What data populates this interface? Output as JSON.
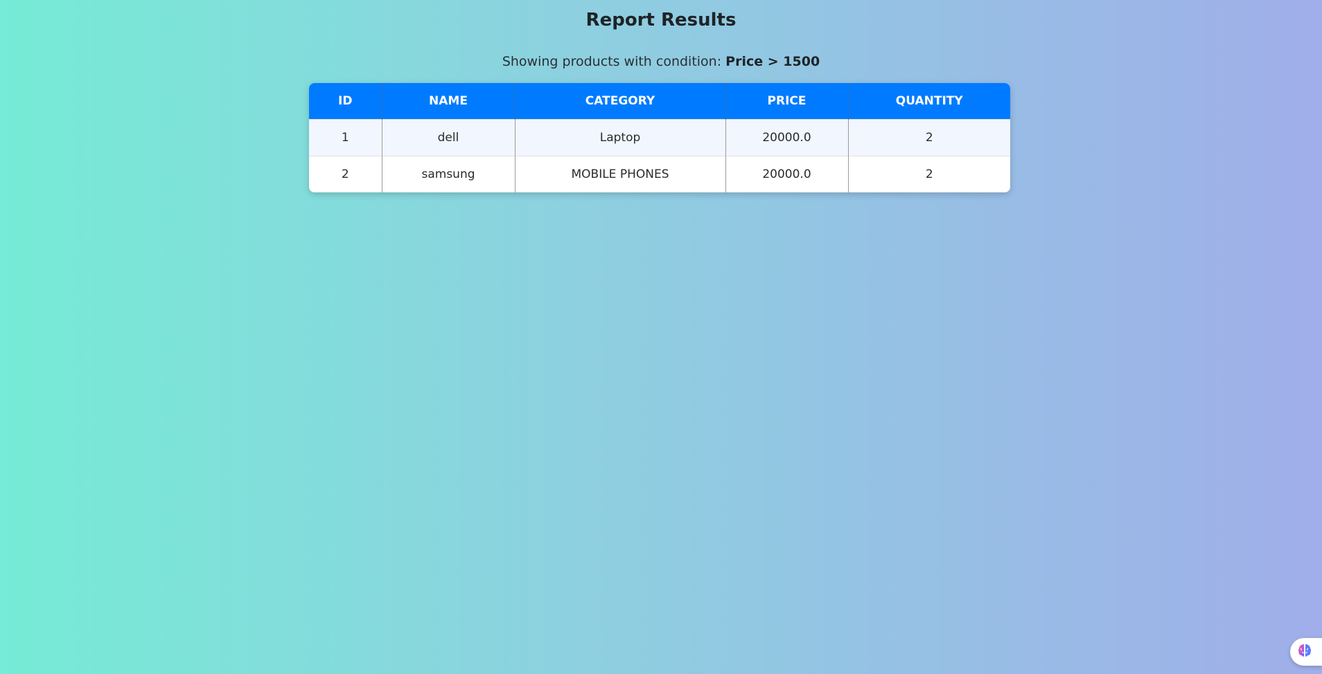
{
  "page": {
    "title": "Report Results",
    "subtitle_prefix": "Showing products with condition: ",
    "condition": "Price > 1500"
  },
  "table": {
    "columns": [
      "ID",
      "NAME",
      "CATEGORY",
      "PRICE",
      "QUANTITY"
    ],
    "rows": [
      [
        "1",
        "dell",
        "Laptop",
        "20000.0",
        "2"
      ],
      [
        "2",
        "samsung",
        "MOBILE PHONES",
        "20000.0",
        "2"
      ]
    ]
  },
  "floating_button": {
    "icon": "brain-icon"
  },
  "colors": {
    "header_bg": "#007bff",
    "header_text": "#ffffff",
    "row_alt_bg": "#f1f6ff",
    "bg_gradient_start": "#76ebd6",
    "bg_gradient_end": "#a0aee9"
  }
}
